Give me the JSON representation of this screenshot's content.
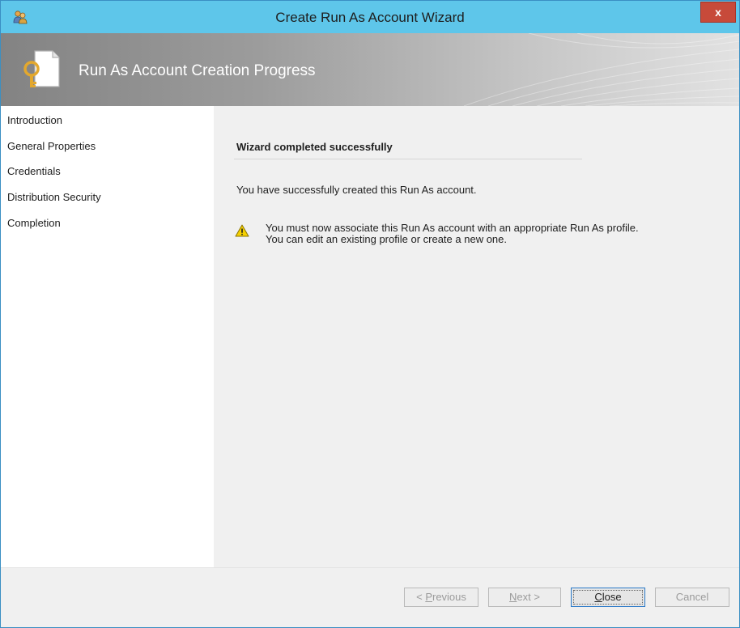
{
  "window": {
    "title": "Create Run As Account Wizard",
    "close_label": "x",
    "app_icon": "run-as-account-icon"
  },
  "banner": {
    "title": "Run As Account Creation Progress",
    "icon": "key-document-icon"
  },
  "nav": {
    "items": [
      {
        "label": "Introduction"
      },
      {
        "label": "General Properties"
      },
      {
        "label": "Credentials"
      },
      {
        "label": "Distribution Security"
      },
      {
        "label": "Completion"
      }
    ]
  },
  "content": {
    "heading": "Wizard completed successfully",
    "success_message": "You have successfully created this Run As account.",
    "warning_line1": "You must now associate this Run As account with an appropriate Run As profile.",
    "warning_line2": "You can edit an existing profile or create a new one.",
    "warning_icon": "warning-icon"
  },
  "buttons": {
    "previous_prefix": "< ",
    "previous_key": "P",
    "previous_rest": "revious",
    "next_key": "N",
    "next_rest": "ext >",
    "close_key": "C",
    "close_rest": "lose",
    "cancel": "Cancel"
  },
  "colors": {
    "titlebar": "#5ec6ea",
    "close_button": "#c74a3a",
    "banner_dark": "#838383",
    "nav_background": "#ffffff",
    "content_background": "#f0f0f0",
    "focus_border": "#2a79c8"
  }
}
